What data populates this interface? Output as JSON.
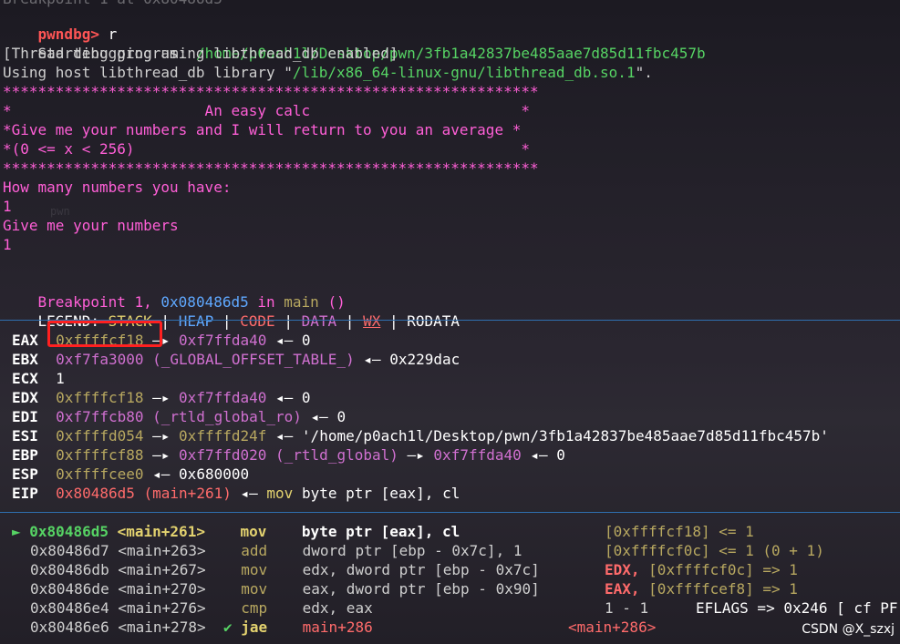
{
  "top_line": "Breakpoint 1 at 0x80486d5",
  "prompt": "pwndbg>",
  "command": "r",
  "start": {
    "label": "Starting program:",
    "path": "/home/p0ach1l/Desktop/pwn/3fb1a42837be485aae7d85d11fbc457b"
  },
  "thread1": "[Thread debugging using libthread_db enabled]",
  "thread2a": "Using host libthread_db library \"",
  "thread2_path": "/lib/x86_64-linux-gnu/libthread_db.so.1",
  "thread2b": "\".",
  "banner": [
    "*************************************************************",
    "*                      An easy calc                        *",
    "*Give me your numbers and I will return to you an average *",
    "*(0 <= x < 256)                                            *",
    "*************************************************************"
  ],
  "io": [
    "How many numbers you have:",
    "1",
    "Give me your numbers",
    "1"
  ],
  "bg_word": "pwn",
  "bp": {
    "text": "Breakpoint 1,",
    "addr": "0x080486d5",
    "in": "in",
    "func": "main",
    "args": "()"
  },
  "legend": {
    "label": "LEGEND:",
    "stack": "STACK",
    "heap": "HEAP",
    "code": "CODE",
    "data": "DATA",
    "wx": "WX",
    "rodata": "RODATA",
    "sep": "|"
  },
  "registers": {
    "eax": {
      "name": "EAX",
      "v1": "0xffffcf18",
      "arrow1": "—▸",
      "v2": "0xf7ffda40",
      "arrow2": "◂—",
      "v3": "0"
    },
    "ebx": {
      "name": "EBX",
      "v1": "0xf7fa3000",
      "sym": "(_GLOBAL_OFFSET_TABLE_)",
      "arrow": "◂—",
      "v2": "0x229dac"
    },
    "ecx": {
      "name": "ECX",
      "v1": "1"
    },
    "edx": {
      "name": "EDX",
      "v1": "0xffffcf18",
      "arrow1": "—▸",
      "v2": "0xf7ffda40",
      "arrow2": "◂—",
      "v3": "0"
    },
    "edi": {
      "name": "EDI",
      "v1": "0xf7ffcb80",
      "sym": "(_rtld_global_ro)",
      "arrow": "◂—",
      "v2": "0"
    },
    "esi": {
      "name": "ESI",
      "v1": "0xffffd054",
      "arrow1": "—▸",
      "v2": "0xffffd24f",
      "arrow2": "◂—",
      "v3": "'/home/p0ach1l/Desktop/pwn/3fb1a42837be485aae7d85d11fbc457b'"
    },
    "ebp": {
      "name": "EBP",
      "v1": "0xffffcf88",
      "arrow1": "—▸",
      "v2": "0xf7ffd020",
      "sym": "(_rtld_global)",
      "arrow2": "—▸",
      "v3": "0xf7ffda40",
      "arrow3": "◂—",
      "v4": "0"
    },
    "esp": {
      "name": "ESP",
      "v1": "0xffffcee0",
      "arrow": "◂—",
      "v2": "0x680000"
    },
    "eip": {
      "name": "EIP",
      "v1": "0x80486d5",
      "sym": "(main+261)",
      "arrow": "◂—",
      "op": "mov",
      "args": "byte ptr [eax], cl"
    }
  },
  "disasm": [
    {
      "marker": "►",
      "addr": "0x80486d5",
      "sym": "<main+261>",
      "mn": "mov",
      "ops": "byte ptr [eax], cl",
      "cmt": "[0xffffcf18] <= 1"
    },
    {
      "marker": "",
      "addr": "0x80486d7",
      "sym": "<main+263>",
      "mn": "add",
      "ops": "dword ptr [ebp - 0x7c], 1",
      "cmt": "[0xffffcf0c] <= 1 (0 + 1)"
    },
    {
      "marker": "",
      "addr": "0x80486db",
      "sym": "<main+267>",
      "mn": "mov",
      "ops": "edx, dword ptr [ebp - 0x7c]",
      "reg": "EDX,",
      "cmt": "[0xffffcf0c] => 1"
    },
    {
      "marker": "",
      "addr": "0x80486de",
      "sym": "<main+270>",
      "mn": "mov",
      "ops": "eax, dword ptr [ebp - 0x90]",
      "reg": "EAX,",
      "cmt": "[0xffffcef8] => 1"
    },
    {
      "marker": "",
      "addr": "0x80486e4",
      "sym": "<main+276>",
      "mn": "cmp",
      "ops": "edx, eax",
      "cmt": "1 - 1",
      "flags": "EFLAGS => 0x246 [ cf PF"
    },
    {
      "marker": "",
      "addr": "0x80486e6",
      "sym": "<main+278>",
      "check": "✔",
      "mn": "jae",
      "ops": "main+286",
      "cmt": "<main+286>"
    }
  ],
  "watermark": "CSDN @X_szxj",
  "colors": {
    "highlight_box": "#ff2020",
    "separator": "#2f6fb0"
  }
}
